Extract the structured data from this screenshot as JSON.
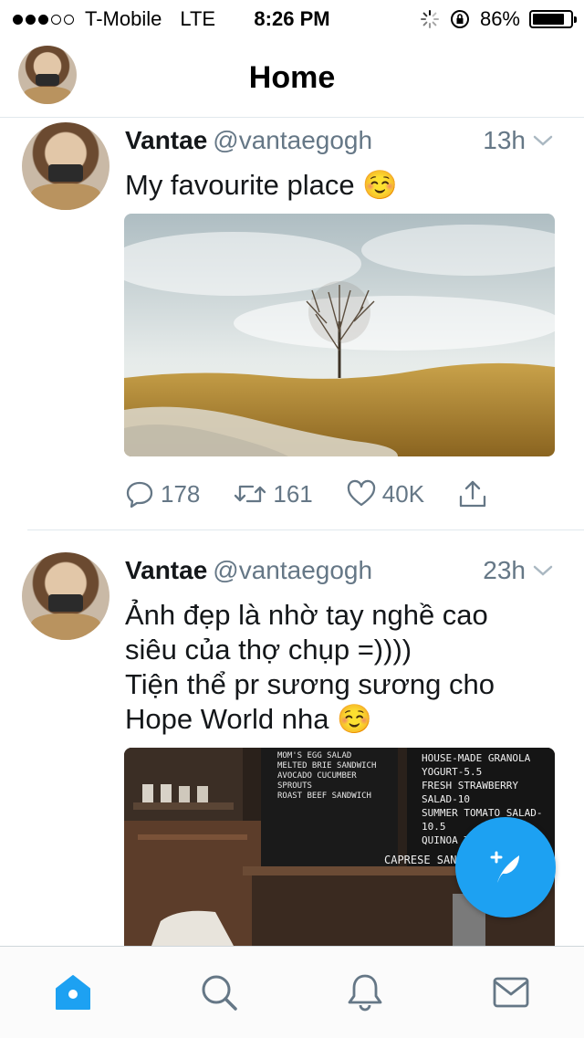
{
  "status_bar": {
    "carrier": "T-Mobile",
    "network": "LTE",
    "time": "8:26 PM",
    "battery": "86%",
    "battery_level": 0.86,
    "signal_bars": 3,
    "signal_total": 5
  },
  "header": {
    "title": "Home"
  },
  "tweets": [
    {
      "name": "Vantae",
      "handle": "@vantaegogh",
      "age": "13h",
      "text": "My favourite place ☺️",
      "replies": "178",
      "retweets": "161",
      "likes": "40K"
    },
    {
      "name": "Vantae",
      "handle": "@vantaegogh",
      "age": "23h",
      "text_lines": [
        "Ảnh đẹp là nhờ tay nghề cao",
        "siêu của thợ chụp =))))",
        "Tiện thể pr sương sương cho",
        "Hope World nha ☺️"
      ],
      "menu_lines": [
        "HOUSE-MADE GRANOLA",
        "YOGURT-5.5",
        "FRESH STRAWBERRY SALAD-10",
        "SUMMER TOMATO SALAD-10.5",
        "QUINOA TABOULI",
        "CAPRESE SANDWICH",
        "MOM'S EGG SALAD",
        "MELTED BRIE SANDWICH",
        "AVOCADO CUCUMBER SPROUTS",
        "ROAST BEEF SANDWICH"
      ]
    }
  ],
  "icons": {
    "reply": "reply-icon",
    "retweet": "retweet-icon",
    "like": "like-icon",
    "share": "share-icon",
    "caret": "chevron-down-icon",
    "compose": "compose-tweet-icon",
    "tabs": [
      "home-icon",
      "search-icon",
      "notifications-icon",
      "messages-icon"
    ]
  },
  "colors": {
    "accent": "#1da1f2",
    "secondary_text": "#657786",
    "divider": "#e1e8ed"
  }
}
